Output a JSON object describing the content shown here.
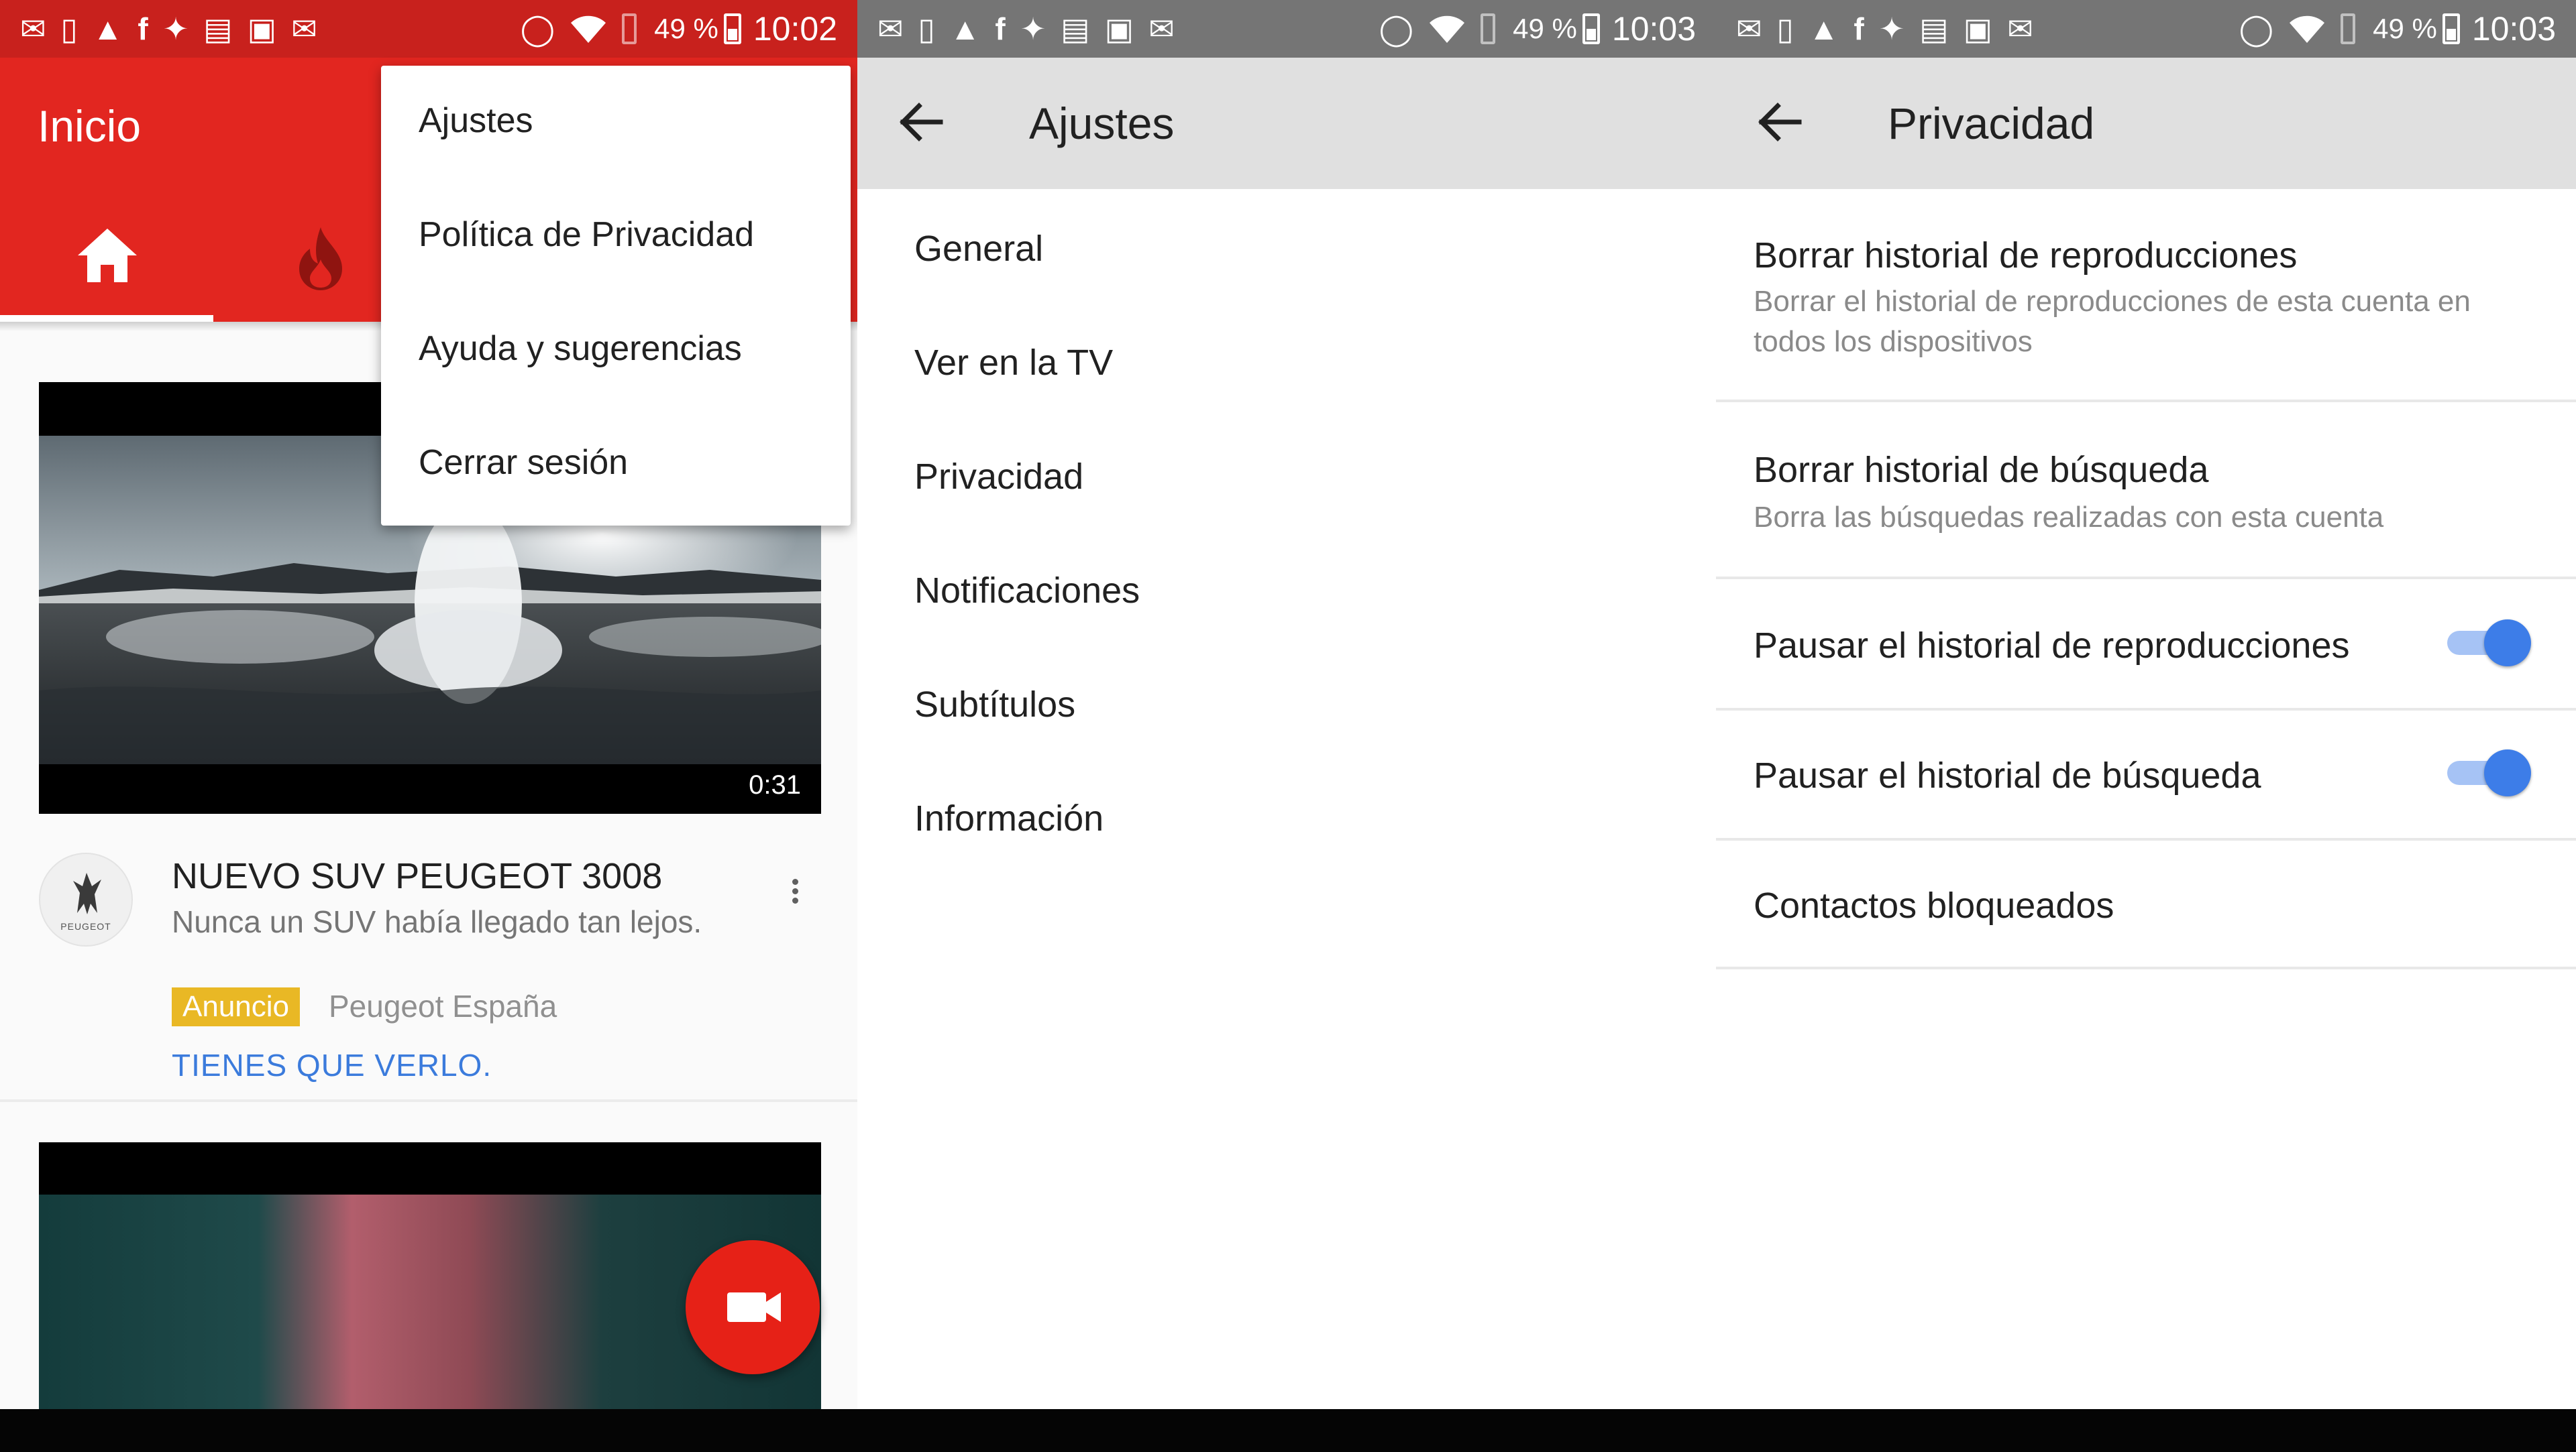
{
  "status_bars": [
    {
      "battery": "49 %",
      "time": "10:02"
    },
    {
      "battery": "49 %",
      "time": "10:03"
    },
    {
      "battery": "49 %",
      "time": "10:03"
    }
  ],
  "status_icons": [
    "message-icon",
    "sim-icon",
    "cleaner-icon",
    "facebook-icon",
    "twitter-icon",
    "photo-icon",
    "image-icon",
    "mail-icon",
    "vibrate-icon",
    "wifi-icon",
    "battery-icon"
  ],
  "home": {
    "title": "Inicio",
    "tabs": [
      {
        "icon": "home-icon"
      },
      {
        "icon": "trending-fire-icon"
      }
    ],
    "menu": [
      "Ajustes",
      "Política de Privacidad",
      "Ayuda y sugerencias",
      "Cerrar sesión"
    ],
    "video": {
      "duration": "0:31",
      "title": "NUEVO SUV PEUGEOT 3008",
      "description": "Nunca un SUV había llegado tan lejos.",
      "badge": "Anuncio",
      "channel": "Peugeot España",
      "cta": "TIENES QUE VERLO.",
      "avatar_text": "PEUGEOT"
    },
    "fab_icon": "video-camera-icon",
    "colors": {
      "brand": "#e22620",
      "badge": "#e9b825",
      "cta": "#3b7bdc"
    }
  },
  "settings": {
    "title": "Ajustes",
    "items": [
      "General",
      "Ver en la TV",
      "Privacidad",
      "Notificaciones",
      "Subtítulos",
      "Información"
    ]
  },
  "privacy": {
    "title": "Privacidad",
    "items": [
      {
        "title": "Borrar historial de reproducciones",
        "subtitle": "Borrar el historial de reproducciones de esta cuenta en todos los dispositivos"
      },
      {
        "title": "Borrar historial de búsqueda",
        "subtitle": "Borra las búsquedas realizadas con esta cuenta"
      },
      {
        "title": "Pausar el historial de reproducciones",
        "toggle": true
      },
      {
        "title": "Pausar el historial de búsqueda",
        "toggle": true
      },
      {
        "title": "Contactos bloqueados"
      }
    ],
    "colors": {
      "toggle_on": "#3d7de8"
    }
  }
}
